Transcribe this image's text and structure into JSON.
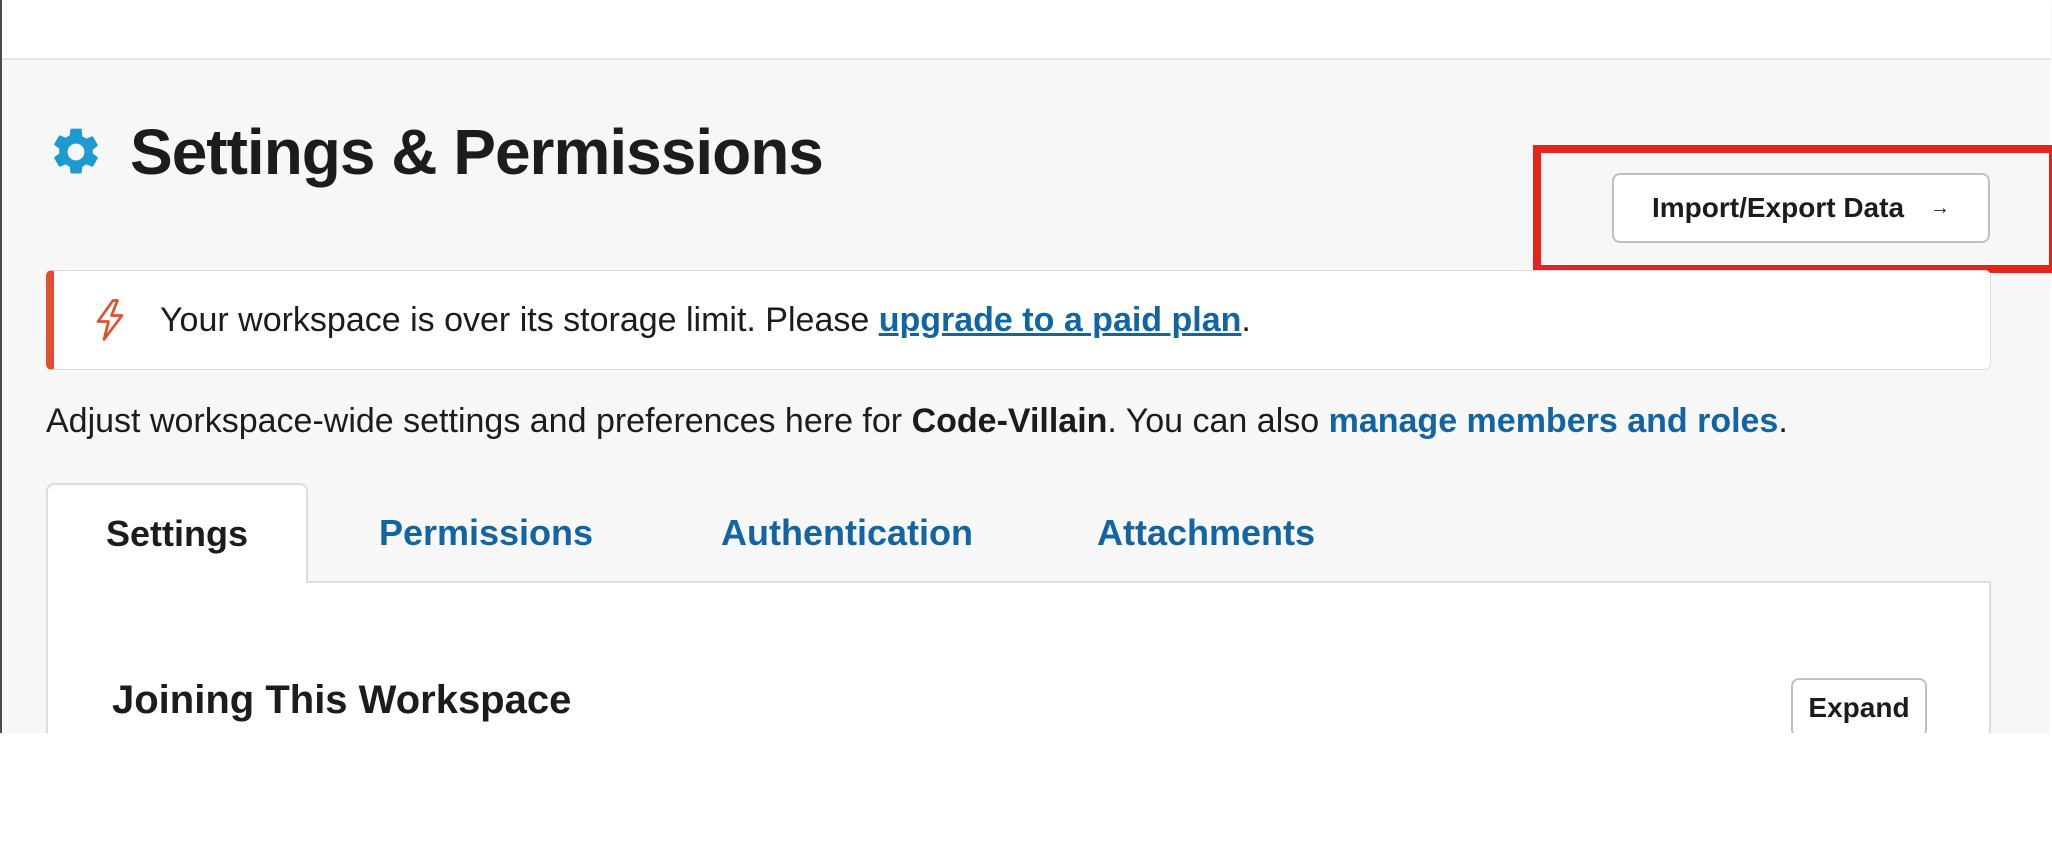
{
  "header": {
    "title": "Settings & Permissions",
    "gear_icon": "gear-icon",
    "accent_color": "#1d9bd1"
  },
  "import_button": {
    "label": "Import/Export Data",
    "arrow": "→"
  },
  "banner": {
    "icon": "lightning-bolt-icon",
    "text_before": "Your workspace is over its storage limit. Please ",
    "link_text": "upgrade to a paid plan",
    "text_after": ".",
    "accent_color": "#e0522f"
  },
  "description": {
    "text_before": "Adjust workspace-wide settings and preferences here for ",
    "workspace_name": "Code-Villain",
    "text_middle": ". You can also ",
    "link_text": "manage members and roles",
    "text_after": "."
  },
  "tabs": [
    {
      "label": "Settings",
      "active": true
    },
    {
      "label": "Permissions",
      "active": false
    },
    {
      "label": "Authentication",
      "active": false
    },
    {
      "label": "Attachments",
      "active": false
    }
  ],
  "section": {
    "title": "Joining This Workspace",
    "expand_label": "Expand"
  },
  "colors": {
    "link": "#1264a3",
    "highlight": "#e5231b"
  }
}
